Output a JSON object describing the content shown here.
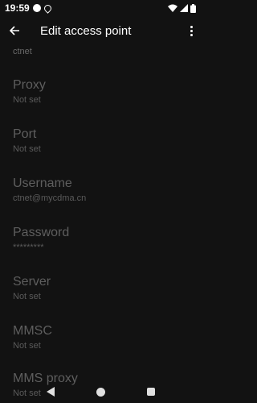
{
  "status_bar": {
    "time": "19:59",
    "icons": [
      "info-icon",
      "location-icon",
      "wifi-icon",
      "signal-icon",
      "battery-icon"
    ]
  },
  "app_bar": {
    "title": "Edit access point",
    "back_icon": "arrow-left-icon",
    "more_icon": "more-vert-icon"
  },
  "list": {
    "partial_summary": "ctnet",
    "items": [
      {
        "title": "Proxy",
        "summary": "Not set"
      },
      {
        "title": "Port",
        "summary": "Not set"
      },
      {
        "title": "Username",
        "summary": "ctnet@mycdma.cn"
      },
      {
        "title": "Password",
        "summary": "*********"
      },
      {
        "title": "Server",
        "summary": "Not set"
      },
      {
        "title": "MMSC",
        "summary": "Not set"
      },
      {
        "title": "MMS proxy",
        "summary": "Not set"
      }
    ]
  },
  "colors": {
    "background": "#121212",
    "disabled_text": "#5e5e5e",
    "icon": "#ffffff"
  }
}
